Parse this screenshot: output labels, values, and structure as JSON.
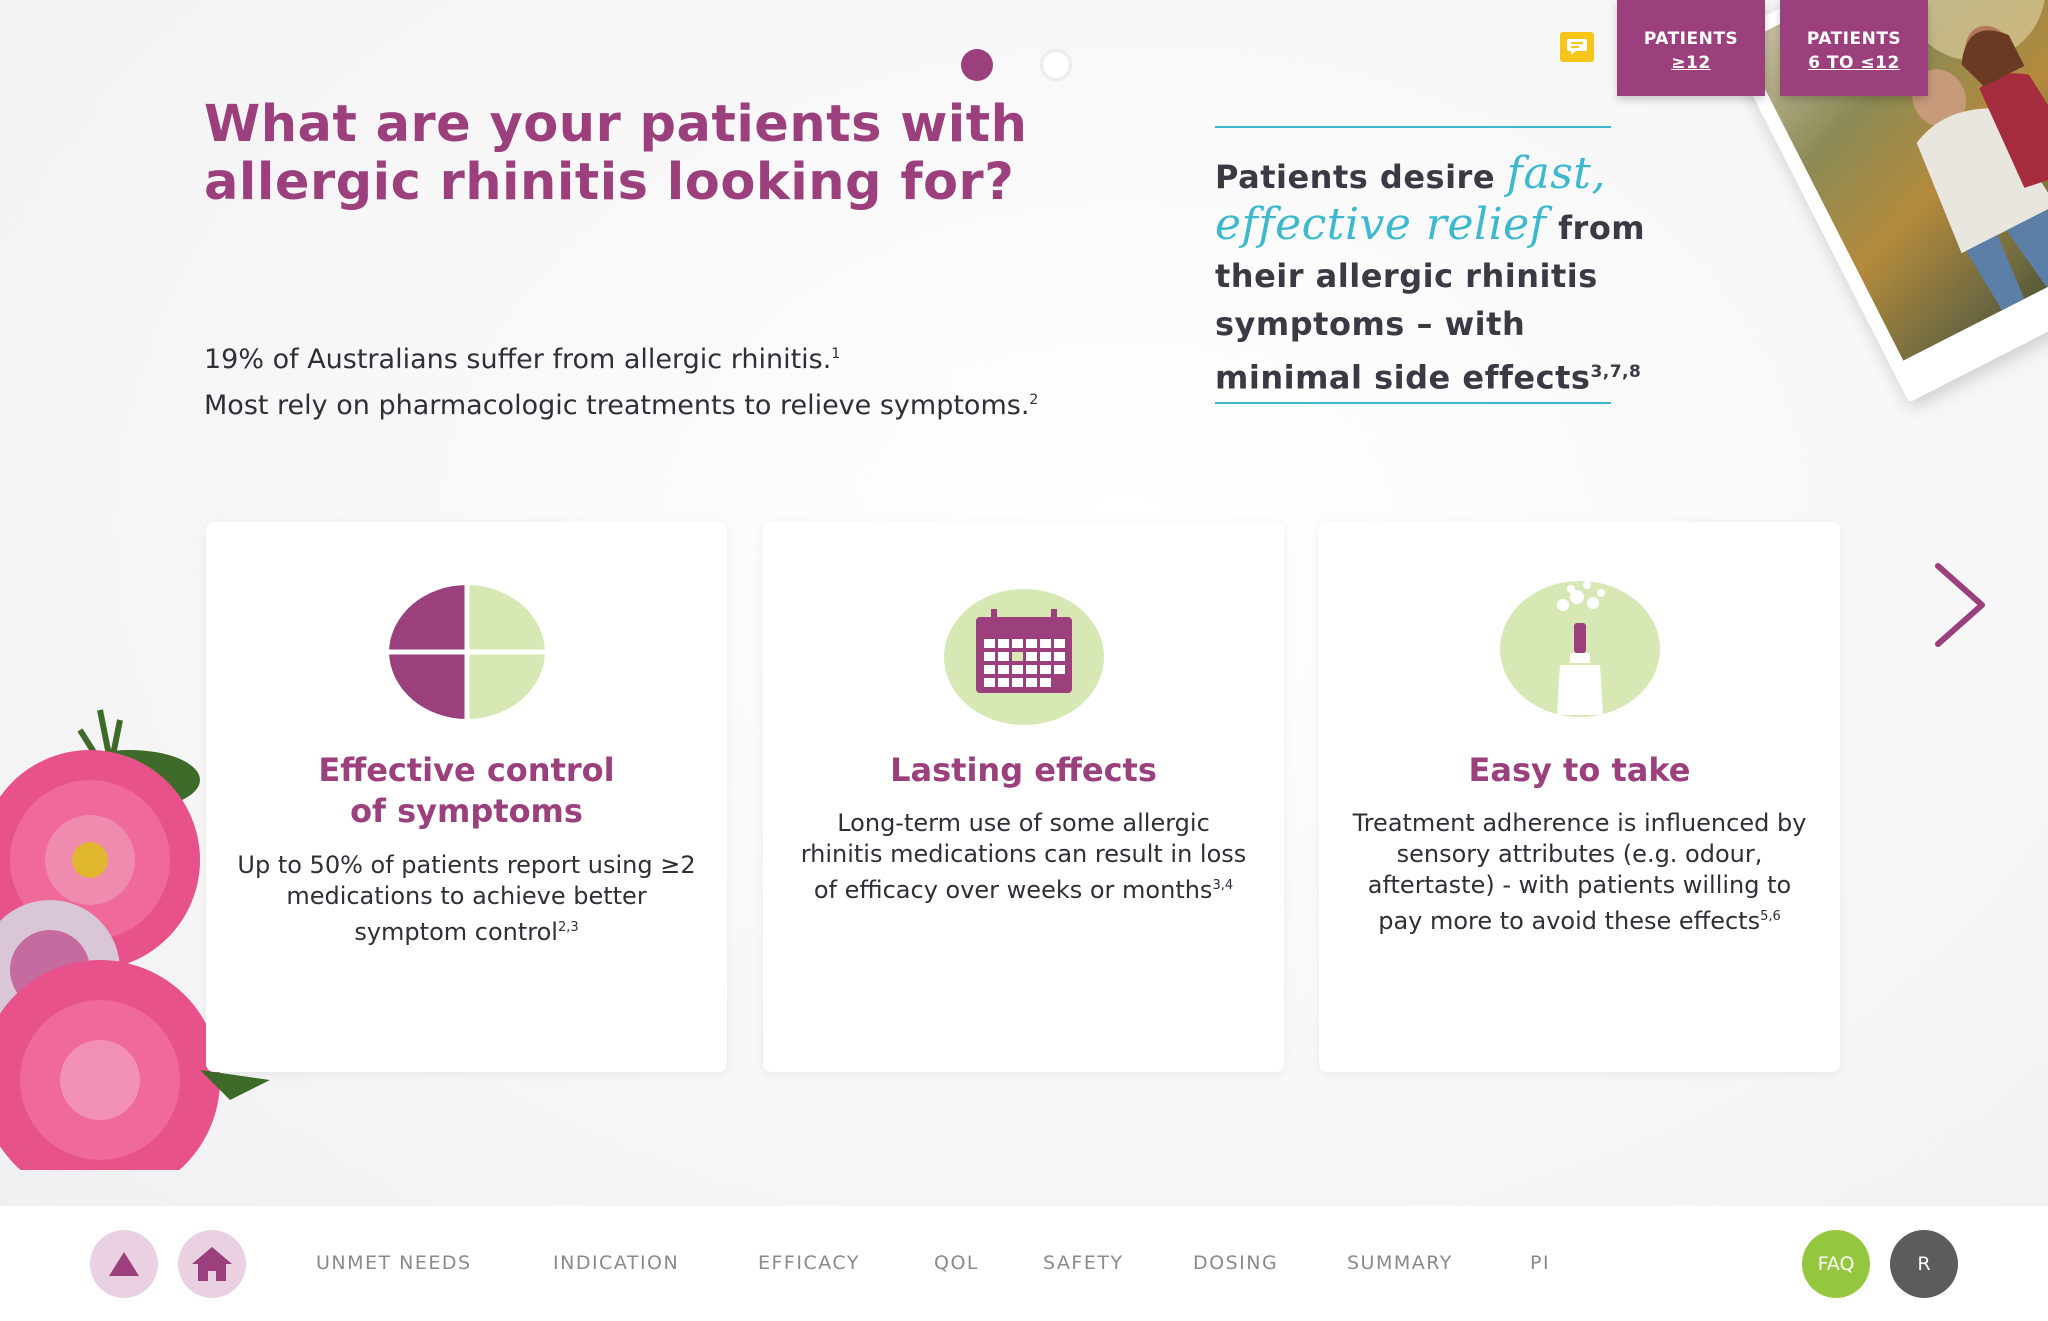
{
  "pager": {
    "active_index": 0,
    "count": 2
  },
  "tabs": {
    "patients_12_line1": "PATIENTS",
    "patients_12_line2": "≥12",
    "patients_6_12_line1": "PATIENTS",
    "patients_6_12_line2": "6 TO ≤12"
  },
  "header": {
    "title_line1": "What are your patients with",
    "title_line2": "allergic rhinitis looking for?"
  },
  "intro": {
    "line1": "19% of Australians suffer from allergic rhinitis.",
    "line1_ref": "1",
    "line2": "Most rely on pharmacologic treatments to relieve symptoms.",
    "line2_ref": "2"
  },
  "quote": {
    "prefix": "Patients desire ",
    "accent_1": "fast,",
    "accent_2": "effective relief",
    "after_accent": " from",
    "line3": "their allergic rhinitis",
    "line4": "symptoms – with",
    "line5": "minimal side effects",
    "ref": "3,7,8"
  },
  "cards": [
    {
      "icon": "pie-chart-icon",
      "title_line1": "Effective control",
      "title_line2": "of symptoms",
      "body": "Up to 50% of patients report using ≥2 medications to achieve better symptom control",
      "ref": "2,3"
    },
    {
      "icon": "calendar-icon",
      "title_line1": "Lasting effects",
      "title_line2": "",
      "body": "Long-term use of some allergic rhinitis medications can result in loss of efficacy over weeks or months",
      "ref": "3,4"
    },
    {
      "icon": "nasal-spray-icon",
      "title_line1": "Easy to take",
      "title_line2": "",
      "body": "Treatment adherence is influenced by sensory attributes (e.g. odour, aftertaste) - with patients willing to pay more to avoid these effects",
      "ref": "5,6"
    }
  ],
  "footer": {
    "nav": [
      "UNMET NEEDS",
      "INDICATION",
      "EFFICACY",
      "QOL",
      "SAFETY",
      "DOSING",
      "SUMMARY",
      "PI"
    ],
    "faq_label": "FAQ",
    "r_label": "R"
  },
  "colors": {
    "brand_purple": "#9b3f7d",
    "accent_cyan": "#3cb8cf",
    "lime": "#d8e8b4",
    "faq_green": "#93c83e",
    "comment_yellow": "#f6c51a"
  }
}
